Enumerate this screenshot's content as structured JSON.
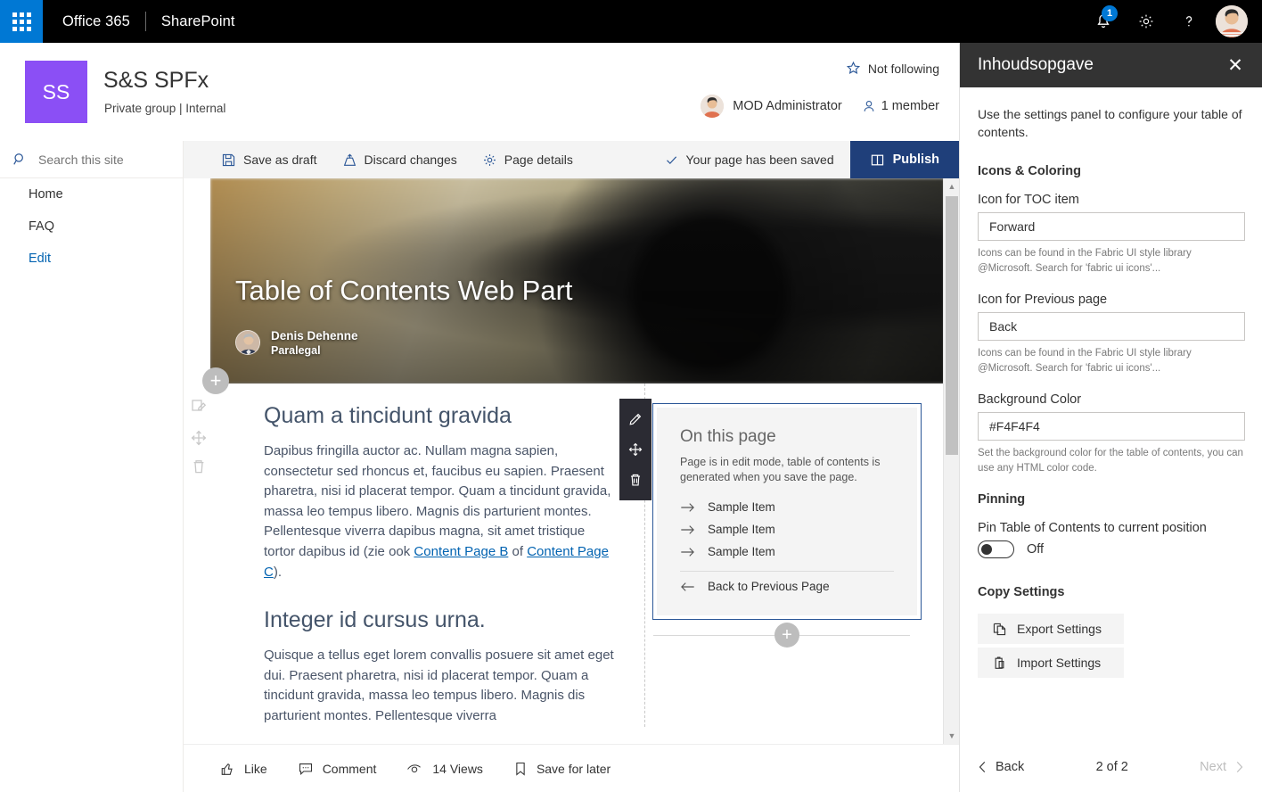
{
  "suite": {
    "waffle_name": "app-launcher",
    "brand": "Office 365",
    "product": "SharePoint",
    "notification_count": "1",
    "settings_icon": "gear-icon",
    "help_icon": "help-icon",
    "avatar": "user-avatar"
  },
  "site": {
    "logo_initials": "SS",
    "title": "S&S SPFx",
    "subtitle": "Private group | Internal",
    "follow_label": "Not following",
    "owner": "MOD Administrator",
    "members": "1 member"
  },
  "nav": {
    "search_placeholder": "Search this site",
    "items": [
      {
        "label": "Home",
        "active": false
      },
      {
        "label": "FAQ",
        "active": false
      },
      {
        "label": "Edit",
        "active": true
      }
    ]
  },
  "commandbar": {
    "save_draft": "Save as draft",
    "discard": "Discard changes",
    "page_details": "Page details",
    "status": "Your page has been saved",
    "publish": "Publish"
  },
  "hero": {
    "title": "Table of Contents Web Part",
    "author": "Denis Dehenne",
    "role": "Paralegal"
  },
  "content": {
    "section1_heading": "Quam a tincidunt gravida",
    "section1_p1": "Dapibus fringilla auctor ac. Nullam magna sapien, consectetur sed rhoncus et, faucibus eu sapien. Praesent pharetra, nisi id placerat tempor. Quam a tincidunt gravida, massa leo tempus libero. Magnis dis parturient montes. Pellentesque viverra dapibus magna, sit amet tristique tortor dapibus id (zie ook ",
    "link_b": "Content Page B",
    "link_join": " of ",
    "link_c": "Content Page C",
    "section1_p1_end": ").",
    "section2_heading": "Integer id cursus urna.",
    "section2_p1": "Quisque a tellus eget lorem convallis posuere sit amet eget dui. Praesent pharetra, nisi id placerat tempor. Quam a tincidunt gravida, massa leo tempus libero. Magnis dis parturient montes. Pellentesque viverra"
  },
  "webpart": {
    "title": "On this page",
    "note": "Page is in edit mode, table of contents is generated when you save the page.",
    "items": [
      "Sample Item",
      "Sample Item",
      "Sample Item"
    ],
    "back_label": "Back to Previous Page",
    "tools": [
      "edit-webpart-icon",
      "move-webpart-icon",
      "delete-webpart-icon"
    ]
  },
  "pagefooter": {
    "like": "Like",
    "comment": "Comment",
    "views": "14 Views",
    "save_later": "Save for later"
  },
  "panel": {
    "title": "Inhoudsopgave",
    "intro": "Use the settings panel to configure your table of contents.",
    "group_icons": "Icons & Coloring",
    "label_toc_icon": "Icon for TOC item",
    "value_toc_icon": "Forward",
    "hint_toc_icon": "Icons can be found in the Fabric UI style library @Microsoft. Search for 'fabric ui icons'...",
    "label_prev_icon": "Icon for Previous page",
    "value_prev_icon": "Back",
    "hint_prev_icon": "Icons can be found in the Fabric UI style library @Microsoft. Search for 'fabric ui icons'...",
    "label_bgcolor": "Background Color",
    "value_bgcolor": "#F4F4F4",
    "hint_bgcolor": "Set the background color for the table of contents, you can use any HTML color code.",
    "group_pinning": "Pinning",
    "label_pin": "Pin Table of Contents to current position",
    "toggle_state": "Off",
    "group_copy": "Copy Settings",
    "export_label": "Export Settings",
    "import_label": "Import Settings",
    "back_label": "Back",
    "page_count": "2 of 2",
    "next_label": "Next"
  },
  "colors": {
    "suite_blue": "#0078d4",
    "site_logo": "#8b4ff5",
    "publish_blue": "#1f3f7a",
    "panel_header": "#333333",
    "accent_link": "#0263b1"
  }
}
